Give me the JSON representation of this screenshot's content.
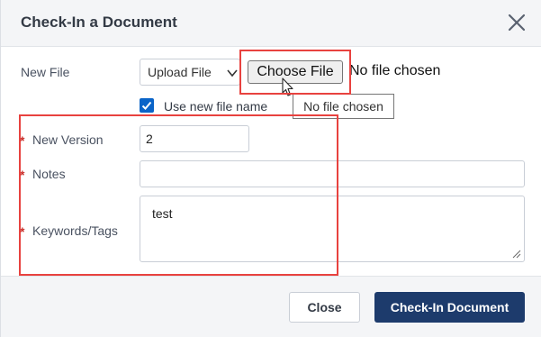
{
  "dialog": {
    "title": "Check-In a Document"
  },
  "form": {
    "new_file_label": "New File",
    "upload_select_value": "Upload File",
    "choose_file_label": "Choose File",
    "no_file_text": "No file chosen",
    "tooltip_text": "No file chosen",
    "use_new_file_name_label": "Use new file name",
    "use_new_file_name_checked": true,
    "required_marker": "*",
    "new_version_label": "New Version",
    "new_version_value": "2",
    "notes_label": "Notes",
    "notes_value": "",
    "keywords_label": "Keywords/Tags",
    "keywords_value": "test"
  },
  "footer": {
    "close_label": "Close",
    "checkin_label": "Check-In Document"
  },
  "colors": {
    "primary": "#1d3b6c",
    "required": "#c8302b",
    "highlight": "#e8423f",
    "checkbox": "#0a64c8"
  },
  "icons": {
    "close": "close-icon",
    "chevron": "chevron-down-icon",
    "check": "checkmark-icon",
    "cursor": "mouse-pointer-icon",
    "resize": "resize-grip-icon"
  }
}
